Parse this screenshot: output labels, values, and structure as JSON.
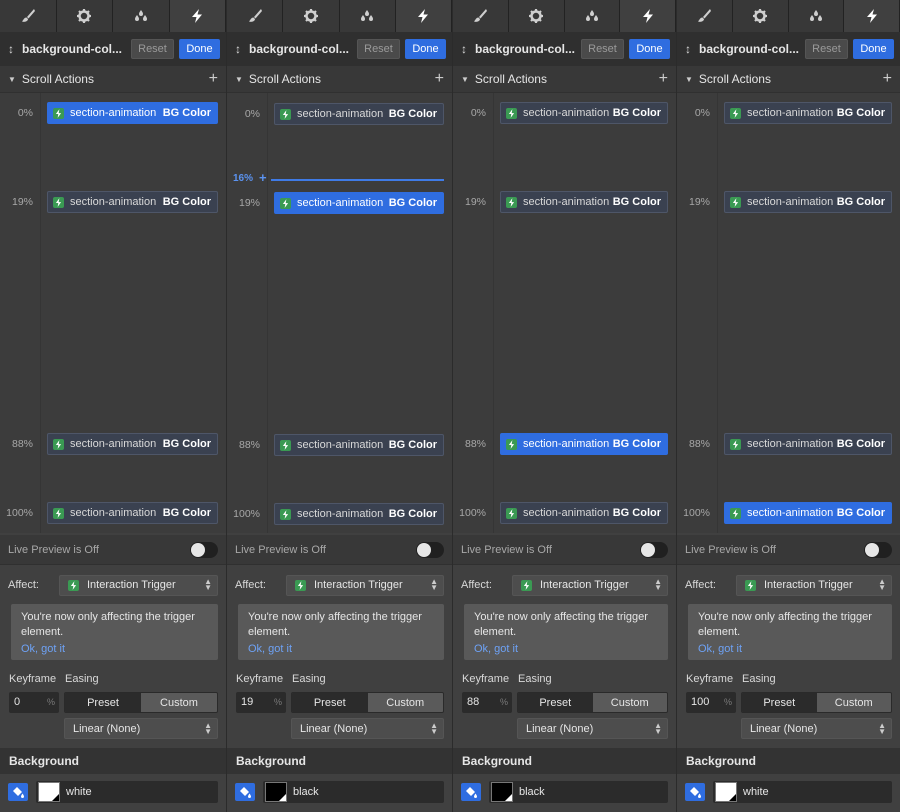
{
  "tab_icons": [
    "brush-icon",
    "gear-icon",
    "drops-icon",
    "lightning-icon"
  ],
  "colors": {
    "accent": "#2f6de0",
    "trigger_green": "#3a9a53",
    "link": "#6ea2f5"
  },
  "panels": [
    {
      "title": "background-col...",
      "reset_label": "Reset",
      "done_label": "Done",
      "section_label": "Scroll Actions",
      "keyframes": [
        {
          "pct_label": "0%",
          "pct": 0,
          "element": "section-animation",
          "action": "BG Color",
          "selected": true
        },
        {
          "pct_label": "19%",
          "pct": 19,
          "element": "section-animation",
          "action": "BG Color",
          "selected": false
        },
        {
          "pct_label": "88%",
          "pct": 88,
          "element": "section-animation",
          "action": "BG Color",
          "selected": false
        },
        {
          "pct_label": "100%",
          "pct": 100,
          "element": "section-animation",
          "action": "BG Color",
          "selected": false
        }
      ],
      "drop_indicator": null,
      "live_preview_label": "Live Preview is Off",
      "affect_label": "Affect:",
      "affect_value": "Interaction Trigger",
      "notice_text": "You're now only affecting the trigger element.",
      "notice_link": "Ok, got it",
      "keyframe_label": "Keyframe",
      "easing_label": "Easing",
      "keyframe_value": "0",
      "keyframe_unit": "%",
      "preset_label": "Preset",
      "custom_label": "Custom",
      "easing_value": "Linear (None)",
      "background_label": "Background",
      "color_name": "white",
      "swatch_color": "#ffffff",
      "corner_color": "#000000"
    },
    {
      "title": "background-col...",
      "reset_label": "Reset",
      "done_label": "Done",
      "section_label": "Scroll Actions",
      "keyframes": [
        {
          "pct_label": "0%",
          "pct": 0,
          "element": "section-animation",
          "action": "BG Color",
          "selected": false
        },
        {
          "pct_label": "19%",
          "pct": 19,
          "element": "section-animation",
          "action": "BG Color",
          "selected": true
        },
        {
          "pct_label": "88%",
          "pct": 88,
          "element": "section-animation",
          "action": "BG Color",
          "selected": false
        },
        {
          "pct_label": "100%",
          "pct": 100,
          "element": "section-animation",
          "action": "BG Color",
          "selected": false
        }
      ],
      "drop_indicator": {
        "pct_label": "16%",
        "pct": 16
      },
      "live_preview_label": "Live Preview is Off",
      "affect_label": "Affect:",
      "affect_value": "Interaction Trigger",
      "notice_text": "You're now only affecting the trigger element.",
      "notice_link": "Ok, got it",
      "keyframe_label": "Keyframe",
      "easing_label": "Easing",
      "keyframe_value": "19",
      "keyframe_unit": "%",
      "preset_label": "Preset",
      "custom_label": "Custom",
      "easing_value": "Linear (None)",
      "background_label": "Background",
      "color_name": "black",
      "swatch_color": "#000000",
      "corner_color": "#ffffff"
    },
    {
      "title": "background-col...",
      "reset_label": "Reset",
      "done_label": "Done",
      "section_label": "Scroll Actions",
      "keyframes": [
        {
          "pct_label": "0%",
          "pct": 0,
          "element": "section-animation",
          "action": "BG Color",
          "selected": false
        },
        {
          "pct_label": "19%",
          "pct": 19,
          "element": "section-animation",
          "action": "BG Color",
          "selected": false
        },
        {
          "pct_label": "88%",
          "pct": 88,
          "element": "section-animation",
          "action": "BG Color",
          "selected": true
        },
        {
          "pct_label": "100%",
          "pct": 100,
          "element": "section-animation",
          "action": "BG Color",
          "selected": false
        }
      ],
      "drop_indicator": null,
      "live_preview_label": "Live Preview is Off",
      "affect_label": "Affect:",
      "affect_value": "Interaction Trigger",
      "notice_text": "You're now only affecting the trigger element.",
      "notice_link": "Ok, got it",
      "keyframe_label": "Keyframe",
      "easing_label": "Easing",
      "keyframe_value": "88",
      "keyframe_unit": "%",
      "preset_label": "Preset",
      "custom_label": "Custom",
      "easing_value": "Linear (None)",
      "background_label": "Background",
      "color_name": "black",
      "swatch_color": "#000000",
      "corner_color": "#ffffff"
    },
    {
      "title": "background-col...",
      "reset_label": "Reset",
      "done_label": "Done",
      "section_label": "Scroll Actions",
      "keyframes": [
        {
          "pct_label": "0%",
          "pct": 0,
          "element": "section-animation",
          "action": "BG Color",
          "selected": false
        },
        {
          "pct_label": "19%",
          "pct": 19,
          "element": "section-animation",
          "action": "BG Color",
          "selected": false
        },
        {
          "pct_label": "88%",
          "pct": 88,
          "element": "section-animation",
          "action": "BG Color",
          "selected": false
        },
        {
          "pct_label": "100%",
          "pct": 100,
          "element": "section-animation",
          "action": "BG Color",
          "selected": true
        }
      ],
      "drop_indicator": null,
      "live_preview_label": "Live Preview is Off",
      "affect_label": "Affect:",
      "affect_value": "Interaction Trigger",
      "notice_text": "You're now only affecting the trigger element.",
      "notice_link": "Ok, got it",
      "keyframe_label": "Keyframe",
      "easing_label": "Easing",
      "keyframe_value": "100",
      "keyframe_unit": "%",
      "preset_label": "Preset",
      "custom_label": "Custom",
      "easing_value": "Linear (None)",
      "background_label": "Background",
      "color_name": "white",
      "swatch_color": "#ffffff",
      "corner_color": "#000000"
    }
  ]
}
